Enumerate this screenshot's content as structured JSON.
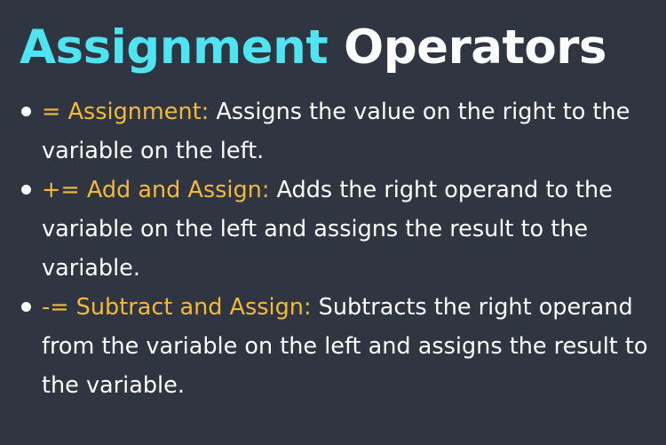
{
  "slide": {
    "title_accent": "Assignment",
    "title_rest": "Operators",
    "colors": {
      "background": "#2f3541",
      "title_accent": "#4ee4f2",
      "term": "#f5b93a",
      "text": "#ffffff"
    },
    "bullets": [
      {
        "term": "= Assignment:",
        "description": "Assigns the value on the right to the variable on the left."
      },
      {
        "term": "+= Add and Assign:",
        "description": "Adds the right operand to the variable on the left and assigns the result to the variable."
      },
      {
        "term": "-= Subtract and Assign:",
        "description": "Subtracts the right operand from the variable on the left and assigns the result to the variable."
      }
    ]
  }
}
